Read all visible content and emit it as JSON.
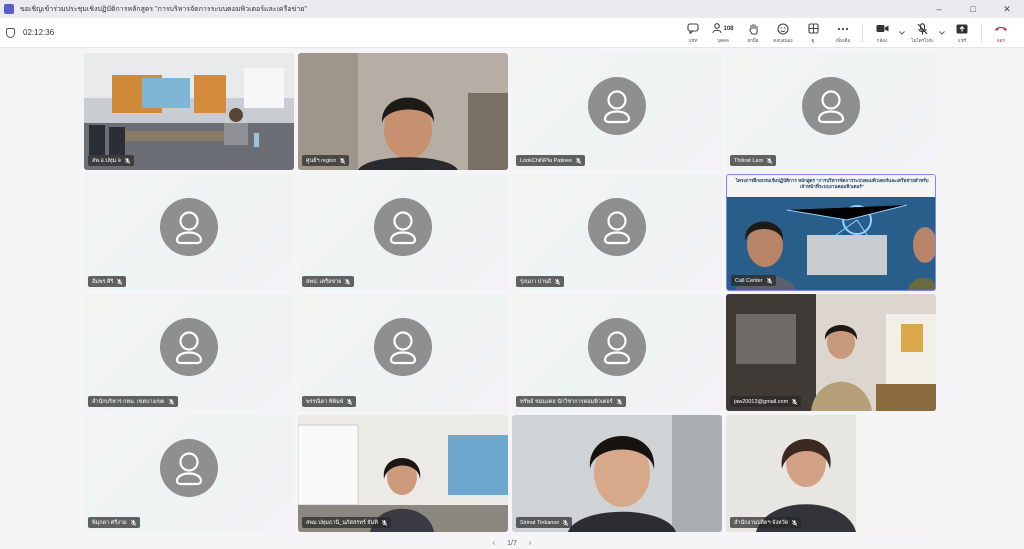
{
  "window": {
    "title": "ขอเชิญเข้าร่วมประชุมเชิงปฏิบัติการหลักสูตร \"การบริหารจัดการระบบคอมพิวเตอร์และเครือข่าย\"",
    "controls": [
      "–",
      "□",
      "✕"
    ]
  },
  "meeting": {
    "timer": "02:12:36",
    "toolbar": {
      "chat": "แชท",
      "people": "บุคคล",
      "people_count": "108",
      "raise": "ยกมือ",
      "react": "ตอบสนอง",
      "view": "ดู",
      "more": "เพิ่มเติม",
      "camera": "กล้อง",
      "mic": "ไมโครโฟน",
      "share": "แชร์",
      "leave": "ออก"
    }
  },
  "tiles": [
    {
      "name": "สพ.อ.ปทุม.จ",
      "type": "video",
      "scene": "room"
    },
    {
      "name": "ศูนย์ฯ region",
      "type": "video",
      "scene": "face"
    },
    {
      "name": "LookChiNPla Patinee",
      "type": "avatar"
    },
    {
      "name": "Thitirat Laor",
      "type": "avatar"
    },
    {
      "name": "อัมพร ศิริ",
      "type": "avatar"
    },
    {
      "name": "สพป. เครือข่าย",
      "type": "avatar"
    },
    {
      "name": "รุ่งนภา ปานธิ",
      "type": "avatar"
    },
    {
      "name": "Call Center",
      "type": "video",
      "scene": "slide",
      "active": true,
      "slide_title": "โครงการฝึกอบรมเชิงปฏิบัติการ หลักสูตร \"การบริหารจัดการระบบคอมพิวเตอร์และเครือข่ายสำหรับเจ้าหน้าที่ระบบงานคอมพิวเตอร์\""
    },
    {
      "name": "สำนักบริหาร กทม. เขตบางเขต",
      "type": "avatar"
    },
    {
      "name": "พรรณิดา พิพิมพ์",
      "type": "avatar"
    },
    {
      "name": "ทรัพย์ ชมมงคล นักวิชาการคอมพิวเตอร์",
      "type": "avatar"
    },
    {
      "name": "jaw20013@gmail.com",
      "type": "video",
      "scene": "office"
    },
    {
      "name": "พิมุกดา ศรีงาม",
      "type": "avatar"
    },
    {
      "name": "สพม.ปทุมธานี_นภัสสรทร์ จันทิ",
      "type": "video",
      "scene": "office2"
    },
    {
      "name": "Sirinat Tinkanon",
      "type": "video",
      "scene": "face2"
    },
    {
      "name": "สำนักงานปลัดฯ จังหวัด",
      "type": "video",
      "scene": "face3"
    }
  ],
  "pager": {
    "label": "1/7",
    "prev": "‹",
    "next": "›"
  },
  "colors": {
    "accent": "#5b5fc7",
    "leave": "#c4314b",
    "avatar": "#8f8f8f"
  }
}
